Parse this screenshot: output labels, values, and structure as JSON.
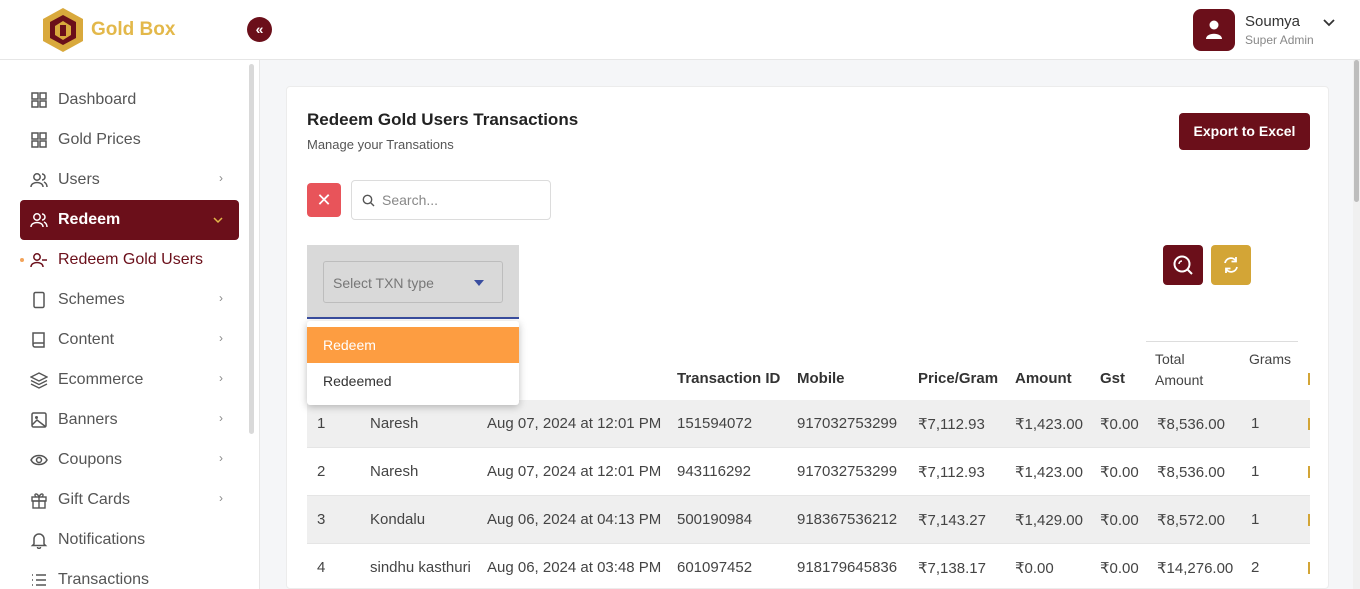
{
  "header": {
    "brand": "Gold Box",
    "collapse_icon": "«",
    "user_name": "Soumya",
    "user_role": "Super Admin"
  },
  "sidebar": {
    "items": [
      {
        "label": "Dashboard",
        "icon": "grid-icon",
        "has_chevron": false
      },
      {
        "label": "Gold Prices",
        "icon": "grid-icon",
        "has_chevron": false
      },
      {
        "label": "Users",
        "icon": "users-icon",
        "has_chevron": true
      },
      {
        "label": "Redeem",
        "icon": "users-icon",
        "has_chevron": true,
        "active": true
      },
      {
        "label": "Redeem Gold Users",
        "icon": "user-minus-icon",
        "has_chevron": false,
        "sub": true
      },
      {
        "label": "Schemes",
        "icon": "phone-icon",
        "has_chevron": true
      },
      {
        "label": "Content",
        "icon": "book-icon",
        "has_chevron": true
      },
      {
        "label": "Ecommerce",
        "icon": "layers-icon",
        "has_chevron": true
      },
      {
        "label": "Banners",
        "icon": "image-icon",
        "has_chevron": true
      },
      {
        "label": "Coupons",
        "icon": "eye-icon",
        "has_chevron": true
      },
      {
        "label": "Gift Cards",
        "icon": "gift-icon",
        "has_chevron": true
      },
      {
        "label": "Notifications",
        "icon": "bell-icon",
        "has_chevron": false
      },
      {
        "label": "Transactions",
        "icon": "list-icon",
        "has_chevron": false
      }
    ]
  },
  "main": {
    "title": "Redeem Gold Users Transactions",
    "subtitle": "Manage your Transations",
    "export_label": "Export to Excel",
    "clear_icon": "✕",
    "search_placeholder": "Search...",
    "select_label": "Select TXN type",
    "dropdown_options": [
      "Redeem",
      "Redeemed"
    ],
    "highlighted_option": "Redeem"
  },
  "table": {
    "headers": {
      "txn_id": "Transaction ID",
      "mobile": "Mobile",
      "price": "Price/Gram",
      "amount": "Amount",
      "gst": "Gst",
      "total_line1": "Total",
      "total_line2": "Amount",
      "grams": "Grams"
    },
    "rows": [
      {
        "no": "1",
        "name": "Naresh",
        "date": "Aug 07, 2024 at 12:01 PM",
        "txn": "151594072",
        "mobile": "917032753299",
        "price": "₹7,112.93",
        "amount": "₹1,423.00",
        "gst": "₹0.00",
        "total": "₹8,536.00",
        "grams": "1"
      },
      {
        "no": "2",
        "name": "Naresh",
        "date": "Aug 07, 2024 at 12:01 PM",
        "txn": "943116292",
        "mobile": "917032753299",
        "price": "₹7,112.93",
        "amount": "₹1,423.00",
        "gst": "₹0.00",
        "total": "₹8,536.00",
        "grams": "1"
      },
      {
        "no": "3",
        "name": "Kondalu",
        "date": "Aug 06, 2024 at 04:13 PM",
        "txn": "500190984",
        "mobile": "918367536212",
        "price": "₹7,143.27",
        "amount": "₹1,429.00",
        "gst": "₹0.00",
        "total": "₹8,572.00",
        "grams": "1"
      },
      {
        "no": "4",
        "name": "sindhu kasthuri",
        "date": "Aug 06, 2024 at 03:48 PM",
        "txn": "601097452",
        "mobile": "918179645836",
        "price": "₹7,138.17",
        "amount": "₹0.00",
        "gst": "₹0.00",
        "total": "₹14,276.00",
        "grams": "2"
      }
    ]
  },
  "colors": {
    "primary": "#6b0f1a",
    "gold": "#d3a536",
    "highlight": "#fd9d41",
    "danger": "#e8545a"
  }
}
